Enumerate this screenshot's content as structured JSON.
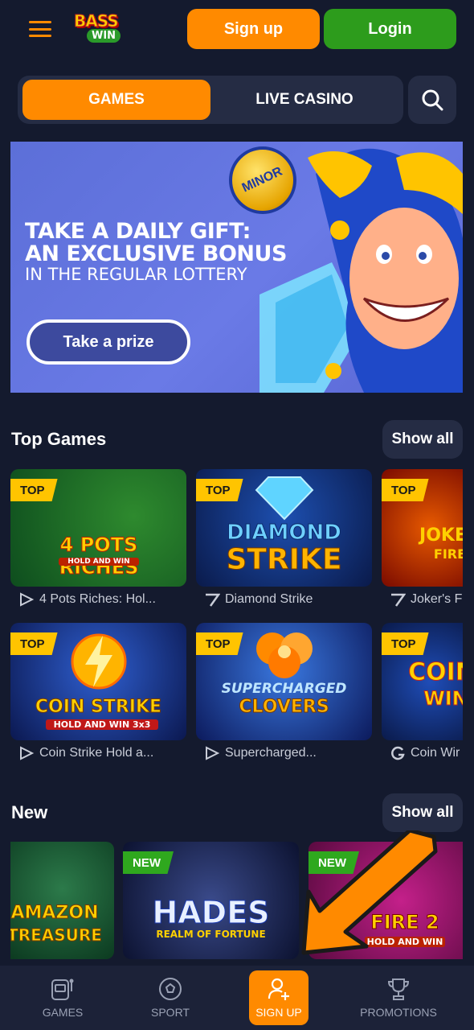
{
  "header": {
    "logo_top": "BASS",
    "logo_bottom": "WIN",
    "signup_label": "Sign up",
    "login_label": "Login"
  },
  "tabs": {
    "games": "GAMES",
    "live_casino": "LIVE CASINO"
  },
  "banner": {
    "badge": "MINOR",
    "line1": "TAKE A DAILY GIFT:",
    "line2": "AN EXCLUSIVE BONUS",
    "line3": "IN THE REGULAR LOTTERY",
    "button": "Take a prize"
  },
  "top_games": {
    "title": "Top Games",
    "show_all": "Show all",
    "badge": "TOP",
    "cards": [
      {
        "art": "4 POTS RICHES",
        "art2": "HOLD AND WIN",
        "label": "4 Pots Riches: Hol..."
      },
      {
        "art": "DIAMOND",
        "art2": "STRIKE",
        "label": "Diamond Strike"
      },
      {
        "art": "JOKER",
        "art2": "FIRE",
        "label": "Joker's F"
      },
      {
        "art": "COIN STRIKE",
        "art2": "HOLD AND WIN 3x3",
        "label": "Coin Strike Hold a..."
      },
      {
        "art": "SUPERCHARGED",
        "art2": "CLOVERS",
        "label": "Supercharged..."
      },
      {
        "art": "COIN",
        "art2": "WIN",
        "label": "Coin Wir"
      }
    ]
  },
  "new_games": {
    "title": "New",
    "show_all": "Show all",
    "badge": "NEW",
    "cards": [
      {
        "art": "AMAZON",
        "art2": "TREASURE"
      },
      {
        "art": "HADES",
        "art2": "REALM OF FORTUNE"
      },
      {
        "art": "FIRE 2",
        "art2": "HOLD AND WIN"
      }
    ]
  },
  "bottom_nav": {
    "games": "GAMES",
    "sport": "SPORT",
    "signup": "SIGN UP",
    "promotions": "PROMOTIONS"
  },
  "colors": {
    "background": "#141a2e",
    "accent_orange": "#ff8a00",
    "login_green": "#2d9c1c",
    "panel": "#252c44",
    "top_badge": "#ffc400"
  }
}
